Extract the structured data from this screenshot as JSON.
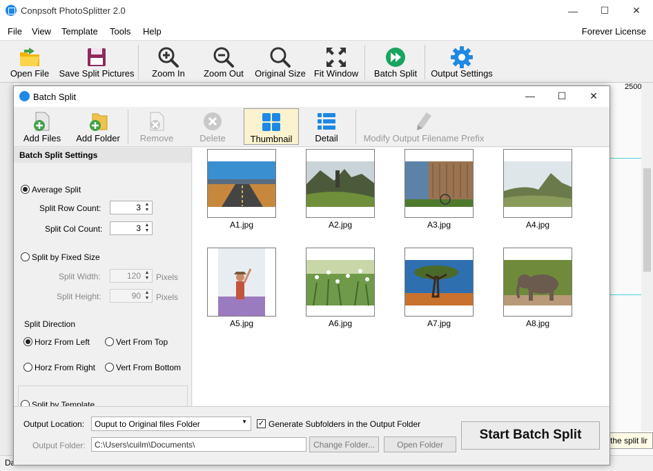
{
  "app": {
    "title": "Conpsoft PhotoSplitter 2.0",
    "license": "Forever License",
    "menus": [
      "File",
      "View",
      "Template",
      "Tools",
      "Help"
    ],
    "toolbar": {
      "open_file": "Open File",
      "save_split_pictures": "Save Split Pictures",
      "zoom_in": "Zoom In",
      "zoom_out": "Zoom Out",
      "original_size": "Original Size",
      "fit_window": "Fit Window",
      "batch_split": "Batch Split",
      "output_settings": "Output Settings"
    },
    "ruler_value": "2500",
    "tooltip": "the split lir",
    "status_text": "Da"
  },
  "dialog": {
    "title": "Batch Split",
    "toolbar": {
      "add_files": "Add Files",
      "add_folder": "Add Folder",
      "remove": "Remove",
      "delete": "Delete",
      "thumbnail": "Thumbnail",
      "detail": "Detail",
      "modify_prefix": "Modify Output Filename Prefix"
    },
    "settings": {
      "header": "Batch Split Settings",
      "average_split": "Average Split",
      "row_count_label": "Split Row Count:",
      "row_count": "3",
      "col_count_label": "Split Col Count:",
      "col_count": "3",
      "fixed_size": "Split by Fixed Size",
      "width_label": "Split Width:",
      "width_value": "120",
      "height_label": "Split Height:",
      "height_value": "90",
      "pixels_unit": "Pixels",
      "direction_label": "Split Direction",
      "horz_left": "Horz From Left",
      "vert_top": "Vert From Top",
      "horz_right": "Horz From Right",
      "vert_bottom": "Vert From Bottom",
      "template_partial": "Split by Template"
    },
    "files": [
      {
        "name": "A1.jpg"
      },
      {
        "name": "A2.jpg"
      },
      {
        "name": "A3.jpg"
      },
      {
        "name": "A4.jpg"
      },
      {
        "name": "A5.jpg"
      },
      {
        "name": "A6.jpg"
      },
      {
        "name": "A7.jpg"
      },
      {
        "name": "A8.jpg"
      }
    ],
    "output": {
      "location_label": "Output Location:",
      "location_value": "Ouput to Original files Folder",
      "generate_subfolders": "Generate Subfolders in the Output Folder",
      "folder_label": "Output Folder:",
      "folder_value": "C:\\Users\\cuilm\\Documents\\",
      "change_folder": "Change Folder...",
      "open_folder": "Open Folder",
      "start": "Start Batch Split"
    }
  }
}
